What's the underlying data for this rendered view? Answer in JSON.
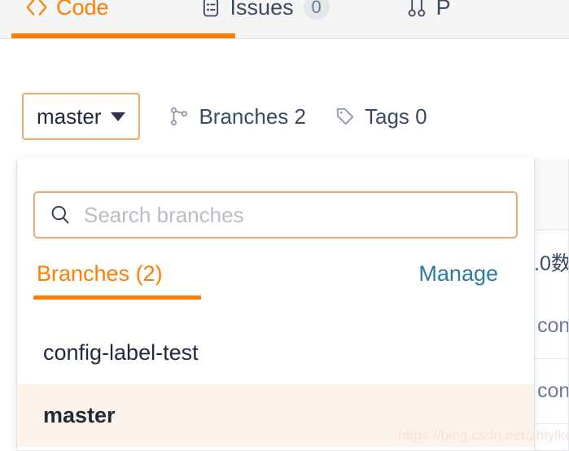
{
  "tabbar": {
    "tabs": [
      {
        "label": "Code",
        "icon": "code-icon",
        "active": true,
        "badge": null
      },
      {
        "label": "Issues",
        "icon": "issues-icon",
        "active": false,
        "badge": "0"
      },
      {
        "label": "P",
        "icon": "pull-request-icon",
        "active": false,
        "badge": null
      }
    ],
    "accent_color": "#ff7d00",
    "inactive_color": "#3b4a63",
    "background_color": "#f5f5f5"
  },
  "toolbar": {
    "branch_button_label": "master",
    "branches_label": "Branches 2",
    "tags_label": "Tags 0",
    "border_color": "#f0a868"
  },
  "dropdown": {
    "search": {
      "placeholder": "Search branches",
      "value": ""
    },
    "tab_label": "Branches (2)",
    "manage_label": "Manage",
    "manage_color": "#2d7a9e",
    "branches": [
      {
        "name": "config-label-test",
        "selected": false
      },
      {
        "name": "master",
        "selected": true
      }
    ],
    "selected_row_color": "#fdf3ea"
  },
  "background_panel": {
    "meta_text": ".0数",
    "rows": [
      {
        "text": "con"
      },
      {
        "text": "con"
      }
    ]
  },
  "watermark": {
    "text": "https://blog.csdn.net/zhiyikeji"
  }
}
